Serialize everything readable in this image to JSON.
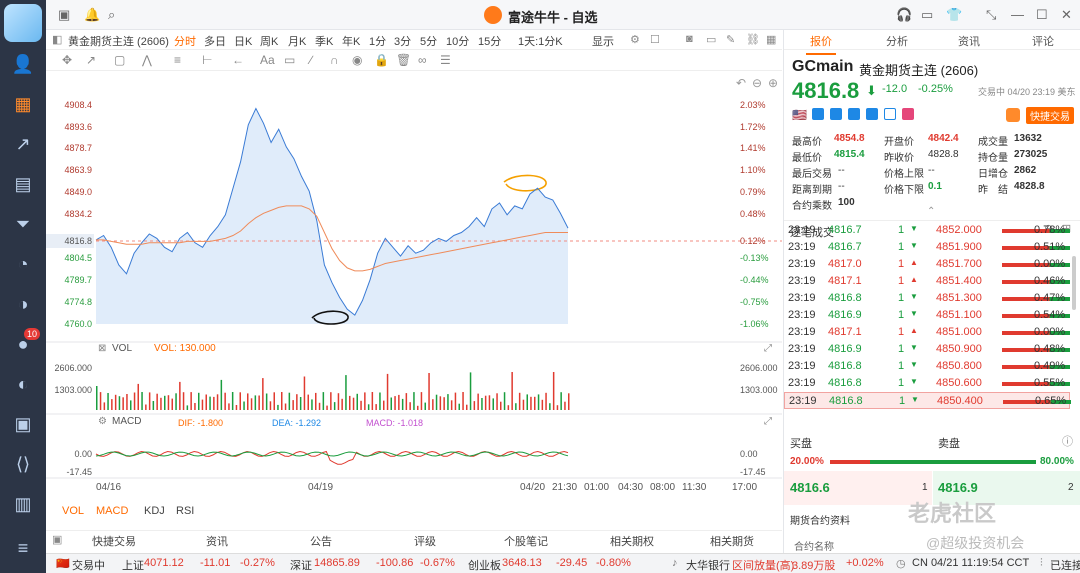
{
  "app": {
    "title": "富途牛牛 - 自选"
  },
  "toolbar": {
    "instrument": "黄金期货主连 (2606)",
    "timeframes": [
      "分时",
      "多日",
      "日K",
      "周K",
      "月K",
      "季K",
      "年K",
      "1分",
      "3分",
      "5分",
      "10分",
      "15分",
      "1天:1分K",
      "显示"
    ],
    "active_timeframe": "分时"
  },
  "chart_data": {
    "type": "line",
    "y_left_ticks": [
      "4908.4",
      "4893.6",
      "4878.7",
      "4863.9",
      "4849.0",
      "4834.2",
      "4816.8",
      "4804.5",
      "4789.7",
      "4774.8",
      "4760.0"
    ],
    "y_right_ticks": [
      "2.03%",
      "1.72%",
      "1.41%",
      "1.10%",
      "0.79%",
      "0.48%",
      "0.12%",
      "-0.13%",
      "-0.44%",
      "-0.75%",
      "-1.06%"
    ],
    "x_labels": [
      "04/16",
      "04/19",
      "04/20",
      "21:30",
      "01:00",
      "04:30",
      "08:00",
      "11:30",
      "17:00"
    ],
    "current": 4816.8,
    "price_series": [
      4817,
      4820,
      4812,
      4800,
      4794,
      4808,
      4815,
      4821,
      4818,
      4812,
      4809,
      4818,
      4822,
      4815,
      4812,
      4820,
      4826,
      4834,
      4852,
      4870,
      4895,
      4906,
      4896,
      4883,
      4892,
      4880,
      4872,
      4860,
      4850,
      4830,
      4800,
      4788,
      4778,
      4770,
      4766,
      4776,
      4790,
      4808,
      4818,
      4812,
      4806,
      4813,
      4808,
      4810,
      4815,
      4818,
      4816,
      4820,
      4822,
      4826,
      4832,
      4826,
      4838,
      4842,
      4834,
      4840,
      4838,
      4848,
      4852,
      4846,
      4844,
      4835,
      4825
    ],
    "avg_series": [
      4817,
      4817,
      4816,
      4815,
      4814,
      4814,
      4814,
      4815,
      4815,
      4815,
      4815,
      4815,
      4816,
      4816,
      4816,
      4816,
      4817,
      4818,
      4820,
      4823,
      4828,
      4832,
      4835,
      4837,
      4839,
      4840,
      4840,
      4840,
      4838,
      4833,
      4822,
      4811,
      4803,
      4798,
      4796,
      4796,
      4797,
      4799,
      4801,
      4802,
      4803,
      4804,
      4805,
      4806,
      4807,
      4808,
      4809,
      4810,
      4811,
      4812,
      4813,
      4814,
      4815,
      4816,
      4817,
      4818,
      4819,
      4820,
      4821,
      4822,
      4822,
      4822,
      4822
    ]
  },
  "vol": {
    "label": "VOL",
    "value_label": "VOL: 130.000",
    "ticks": [
      "2606.000",
      "1303.000"
    ]
  },
  "macd": {
    "label": "MACD",
    "dif": "DIF: -1.800",
    "dea": "DEA: -1.292",
    "macd": "MACD: -1.018",
    "ticks": [
      "0.00",
      "-17.45"
    ]
  },
  "indicator_tabs": [
    "VOL",
    "MACD",
    "KDJ",
    "RSI"
  ],
  "links": [
    "快捷交易",
    "资讯",
    "公告",
    "评级",
    "个股笔记",
    "相关期权",
    "相关期货"
  ],
  "status": {
    "label": "交易中",
    "sh_name": "上证",
    "sh_val": "4071.12",
    "sh_chg": "-11.01",
    "sh_pct": "-0.27%",
    "sz_name": "深证",
    "sz_val": "14865.89",
    "sz_chg": "-100.86",
    "sz_pct": "-0.67%",
    "cy_name": "创业板",
    "cy_val": "3648.13",
    "cy_chg": "-29.45",
    "cy_pct": "-0.80%",
    "bank": "大华银行",
    "interval": "区间放量(高)",
    "amount": "3.89万股",
    "bank_pct": "+0.02%",
    "clock": "CN 04/21 11:19:54 CCT",
    "conn": "已连接"
  },
  "right": {
    "tabs": [
      "报价",
      "分析",
      "资讯",
      "评论"
    ],
    "symbol": "GCmain",
    "name": "黄金期货主连 (2606)",
    "price": "4816.8",
    "change": "-12.0",
    "pct": "-0.25%",
    "tradetime": "交易中 04/20 23:19 美东",
    "quick_trade": "快捷交易",
    "quote": [
      [
        "最高价",
        "4854.8",
        "开盘价",
        "4842.4",
        "成交量",
        "13632"
      ],
      [
        "最低价",
        "4815.4",
        "昨收价",
        "4828.8",
        "持仓量",
        "273025"
      ],
      [
        "最后交易",
        "--",
        "价格上限",
        "--",
        "日增仓",
        "2862"
      ],
      [
        "距离到期",
        "--",
        "价格下限",
        "0.1",
        "昨　结",
        "4828.8"
      ],
      [
        "合约乘数",
        "100",
        "",
        "",
        "",
        ""
      ]
    ],
    "trades_title": "逐笔成交",
    "trades": [
      [
        "23:19",
        "4816.7",
        "1",
        "4852.000",
        "0.78%"
      ],
      [
        "23:19",
        "4816.7",
        "1",
        "4851.900",
        "0.51%"
      ],
      [
        "23:19",
        "4817.0",
        "1",
        "4851.700",
        "0.00%"
      ],
      [
        "23:19",
        "4817.1",
        "1",
        "4851.400",
        "0.46%"
      ],
      [
        "23:19",
        "4816.8",
        "1",
        "4851.300",
        "0.47%"
      ],
      [
        "23:19",
        "4816.9",
        "1",
        "4851.100",
        "0.54%"
      ],
      [
        "23:19",
        "4817.1",
        "1",
        "4851.000",
        "0.00%"
      ],
      [
        "23:19",
        "4816.9",
        "1",
        "4850.900",
        "0.48%"
      ],
      [
        "23:19",
        "4816.8",
        "1",
        "4850.800",
        "0.49%"
      ],
      [
        "23:19",
        "4816.8",
        "1",
        "4850.600",
        "0.55%"
      ],
      [
        "23:19",
        "4816.8",
        "1",
        "4850.400",
        "0.65%"
      ]
    ],
    "buy_label": "买盘",
    "sell_label": "卖盘",
    "buy_pct": "20.00%",
    "sell_pct": "80.00%",
    "bid": "4816.6",
    "bid_qty": "1",
    "ask": "4816.9",
    "ask_qty": "2",
    "contract_title": "期货合约资料",
    "contract_name": "合约名称"
  },
  "watermark": "老虎社区",
  "watermark2": "@超级投资机会"
}
